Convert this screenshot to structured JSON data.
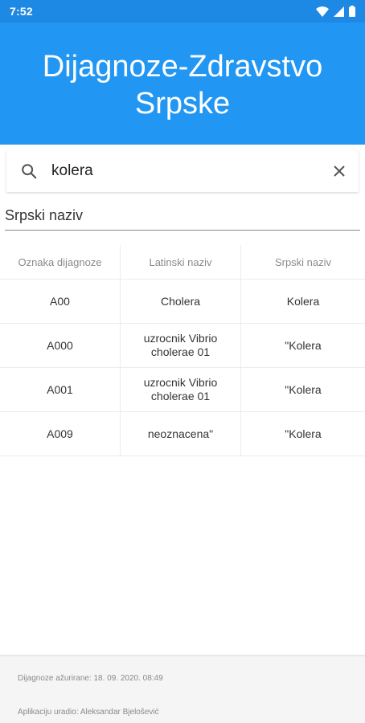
{
  "status_bar": {
    "time": "7:52",
    "icons": [
      "wifi-icon",
      "signal-icon",
      "battery-icon"
    ]
  },
  "header": {
    "title": "Dijagnoze-Zdravstvo Srpske",
    "background": "#2196f3"
  },
  "search": {
    "query": "kolera",
    "icons": {
      "leading": "search-icon",
      "trailing": "close-icon"
    }
  },
  "filter": {
    "selected": "Srpski naziv"
  },
  "table": {
    "columns": [
      "Oznaka dijagnoze",
      "Latinski naziv",
      "Srpski naziv"
    ],
    "rows": [
      [
        "A00",
        "Cholera",
        "Kolera"
      ],
      [
        "A000",
        "uzrocnik Vibrio cholerae 01",
        "\"Kolera"
      ],
      [
        "A001",
        "uzrocnik Vibrio cholerae 01",
        "\"Kolera"
      ],
      [
        "A009",
        "neoznacena\"",
        "\"Kolera"
      ]
    ]
  },
  "footer": {
    "updated": "Dijagnoze ažurirane: 18. 09. 2020. 08:49",
    "author": "Aplikaciju uradio: Aleksandar Bjelošević"
  }
}
